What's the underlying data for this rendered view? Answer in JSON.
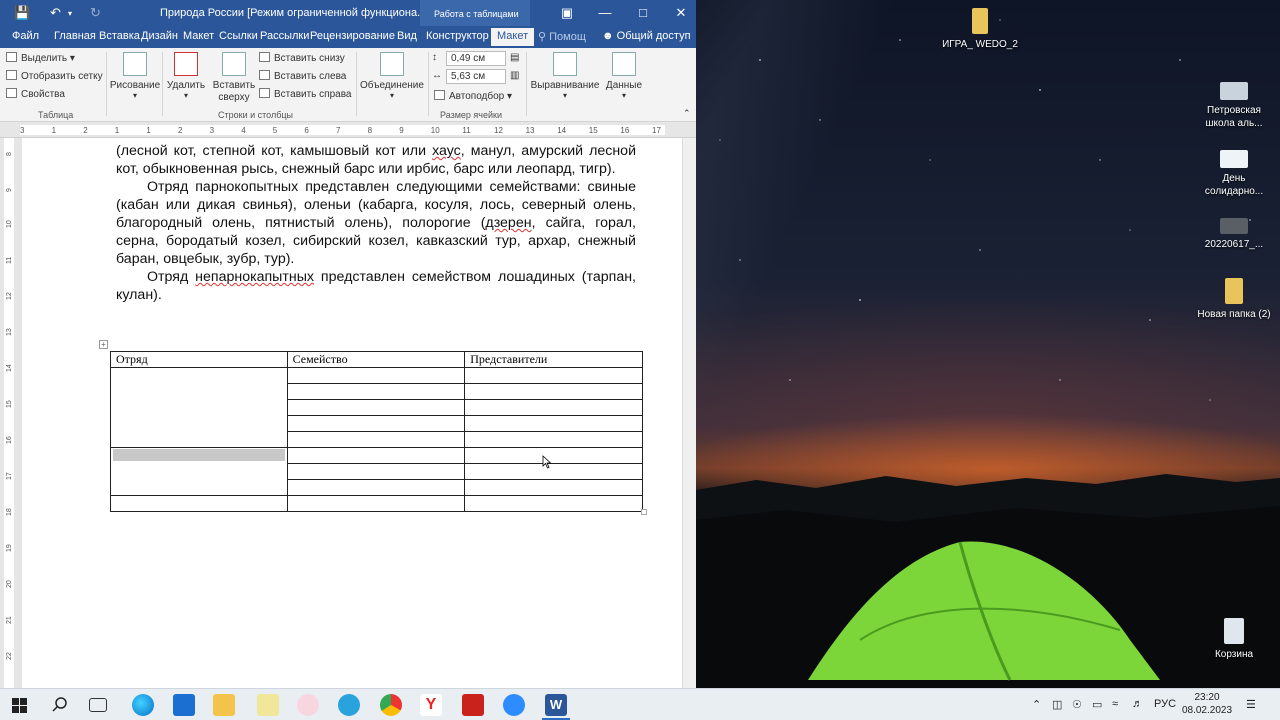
{
  "window": {
    "title": "Природа России [Режим ограниченной функциона...",
    "context_tab": "Работа с таблицами"
  },
  "tabs": [
    "Файл",
    "Главная",
    "Вставка",
    "Дизайн",
    "Макет",
    "Ссылки",
    "Рассылки",
    "Рецензирование",
    "Вид",
    "Конструктор",
    "Макет"
  ],
  "tell_me": "Помощ",
  "share": "Общий доступ",
  "ribbon": {
    "table_group": {
      "select": "Выделить",
      "gridlines": "Отобразить сетку",
      "properties": "Свойства",
      "label": "Таблица"
    },
    "draw": "Рисование",
    "delete": "Удалить",
    "insert_above": "Вставить сверху",
    "insert_below": "Вставить снизу",
    "insert_left": "Вставить слева",
    "insert_right": "Вставить справа",
    "rows_cols_label": "Строки и столбцы",
    "merge": "Объединение",
    "height": "0,49 см",
    "width": "5,63 см",
    "autofit": "Автоподбор",
    "cell_size_label": "Размер ячейки",
    "alignment": "Выравнивание",
    "data": "Данные"
  },
  "ruler": {
    "h_ticks": [
      "3",
      "1",
      "2",
      "1",
      "1",
      "2",
      "3",
      "4",
      "5",
      "6",
      "7",
      "8",
      "9",
      "10",
      "11",
      "12",
      "13",
      "14",
      "15",
      "16",
      "17"
    ],
    "v_ticks": [
      "8",
      "9",
      "10",
      "11",
      "12",
      "13",
      "14",
      "15",
      "16",
      "17",
      "18",
      "19",
      "20",
      "21",
      "22",
      "23"
    ]
  },
  "document": {
    "p1": "(лесной кот, степной кот, камышовый кот или хаус, манул, амурский лесной кот, обыкновенная рысь, снежный барс или ирбис, барс или леопард, тигр).",
    "p2": "Отряд парнокопытных представлен следующими семействами: свиные (кабан или дикая свинья), оленьи (кабарга, косуля, лось, северный олень, благородный олень, пятнистый олень), полорогие (дзерен, сайга, горал, серна, бородатый козел, сибирский козел, кавказский тур, архар, снежный баран, овцебык, зубр, тур).",
    "p3": "Отряд непарнокапытных представлен семейством лошадиных (тарпан, кулан).",
    "table_headers": [
      "Отряд",
      "Семейство",
      "Представители"
    ]
  },
  "desktop_icons": [
    {
      "label": "ИГРА_ WEDO_2"
    },
    {
      "label": "Петровская школа аль..."
    },
    {
      "label": "День солидарно..."
    },
    {
      "label": "20220617_..."
    },
    {
      "label": "Новая папка (2)"
    },
    {
      "label": "Корзина"
    }
  ],
  "taskbar": {
    "lang": "РУС",
    "time": "23:20",
    "date": "08.02.2023"
  },
  "colors": {
    "word_blue": "#2b579a",
    "ribbon_bg": "#f3f3f3",
    "taskbar_bg": "#e9eef3"
  }
}
